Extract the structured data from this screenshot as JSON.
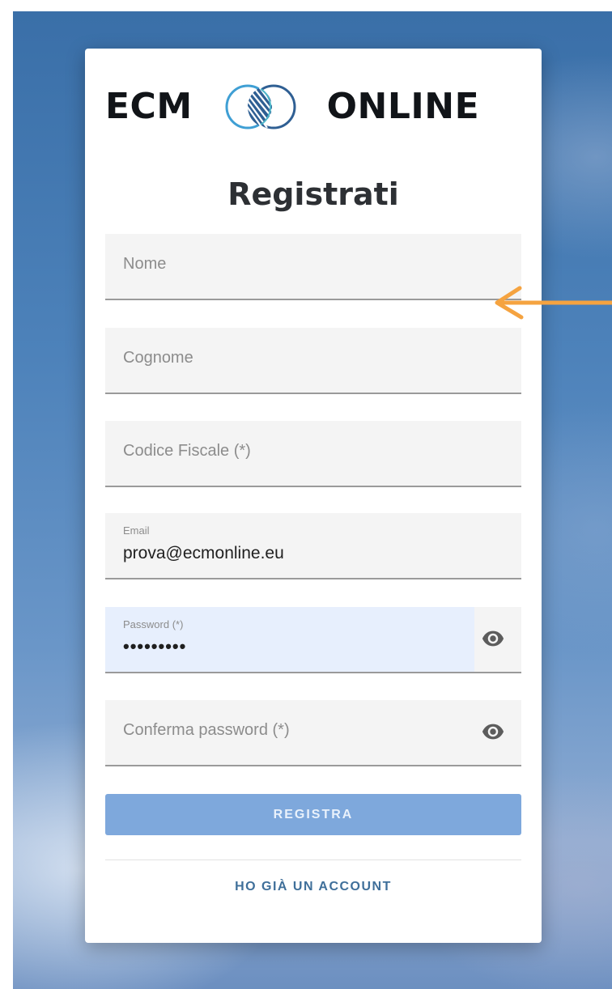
{
  "brand": {
    "logo_left": "ECM",
    "logo_right": "ONLINE",
    "logo_colors": [
      "#2f5f93",
      "#3f9fd4",
      "#4db6c9"
    ]
  },
  "page": {
    "title": "Registrati"
  },
  "form": {
    "nome": {
      "placeholder": "Nome",
      "value": ""
    },
    "cognome": {
      "placeholder": "Cognome",
      "value": ""
    },
    "codice_fiscale": {
      "placeholder": "Codice Fiscale (*)",
      "value": ""
    },
    "email": {
      "label": "Email",
      "value": "prova@ecmonline.eu"
    },
    "password": {
      "label": "Password (*)",
      "masked_value": "•••••••••",
      "icon": "eye-icon"
    },
    "conferma_password": {
      "placeholder": "Conferma password (*)",
      "value": "",
      "icon": "eye-icon"
    },
    "submit_label": "REGISTRA",
    "secondary_label": "HO GIÀ UN ACCOUNT"
  },
  "annotation": {
    "icon": "arrow-left-icon",
    "color": "#f5a340"
  },
  "colors": {
    "primary_button": "#7ea8dc",
    "link_text": "#3f6f9a",
    "autofill_background": "#e7effd"
  }
}
